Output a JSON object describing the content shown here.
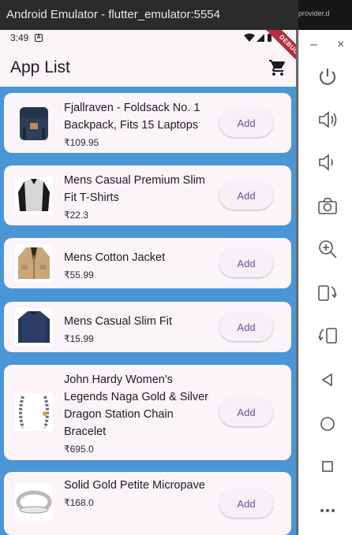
{
  "window": {
    "title": "Android Emulator - flutter_emulator:5554",
    "right_sliver_text": "provider.d"
  },
  "statusbar": {
    "time": "3:49",
    "a_icon": "A"
  },
  "debug_banner": "DEBUG",
  "appbar": {
    "title": "App List",
    "cart_icon": "shopping-cart-icon"
  },
  "products": [
    {
      "title": "Fjallraven - Foldsack No. 1 Backpack, Fits 15 Laptops",
      "price": "₹109.95",
      "button": "Add",
      "image": "backpack"
    },
    {
      "title": "Mens Casual Premium Slim Fit T-Shirts",
      "price": "₹22.3",
      "button": "Add",
      "image": "tshirt"
    },
    {
      "title": "Mens Cotton Jacket",
      "price": "₹55.99",
      "button": "Add",
      "image": "jacket"
    },
    {
      "title": "Mens Casual Slim Fit",
      "price": "₹15.99",
      "button": "Add",
      "image": "sweater"
    },
    {
      "title": "John Hardy Women's Legends Naga Gold & Silver Dragon Station Chain Bracelet",
      "price": "₹695.0",
      "button": "Add",
      "image": "bracelet"
    },
    {
      "title": "Solid Gold Petite Micropave",
      "price": "₹168.0",
      "button": "Add",
      "image": "ring"
    }
  ],
  "emulator_toolbar": {
    "minimize": "–",
    "close": "×",
    "tools": [
      "power-icon",
      "volume-up-icon",
      "volume-down-icon",
      "camera-icon",
      "zoom-in-icon",
      "rotate-left-icon",
      "rotate-right-icon",
      "back-icon",
      "home-icon",
      "overview-icon",
      "more-icon"
    ]
  }
}
